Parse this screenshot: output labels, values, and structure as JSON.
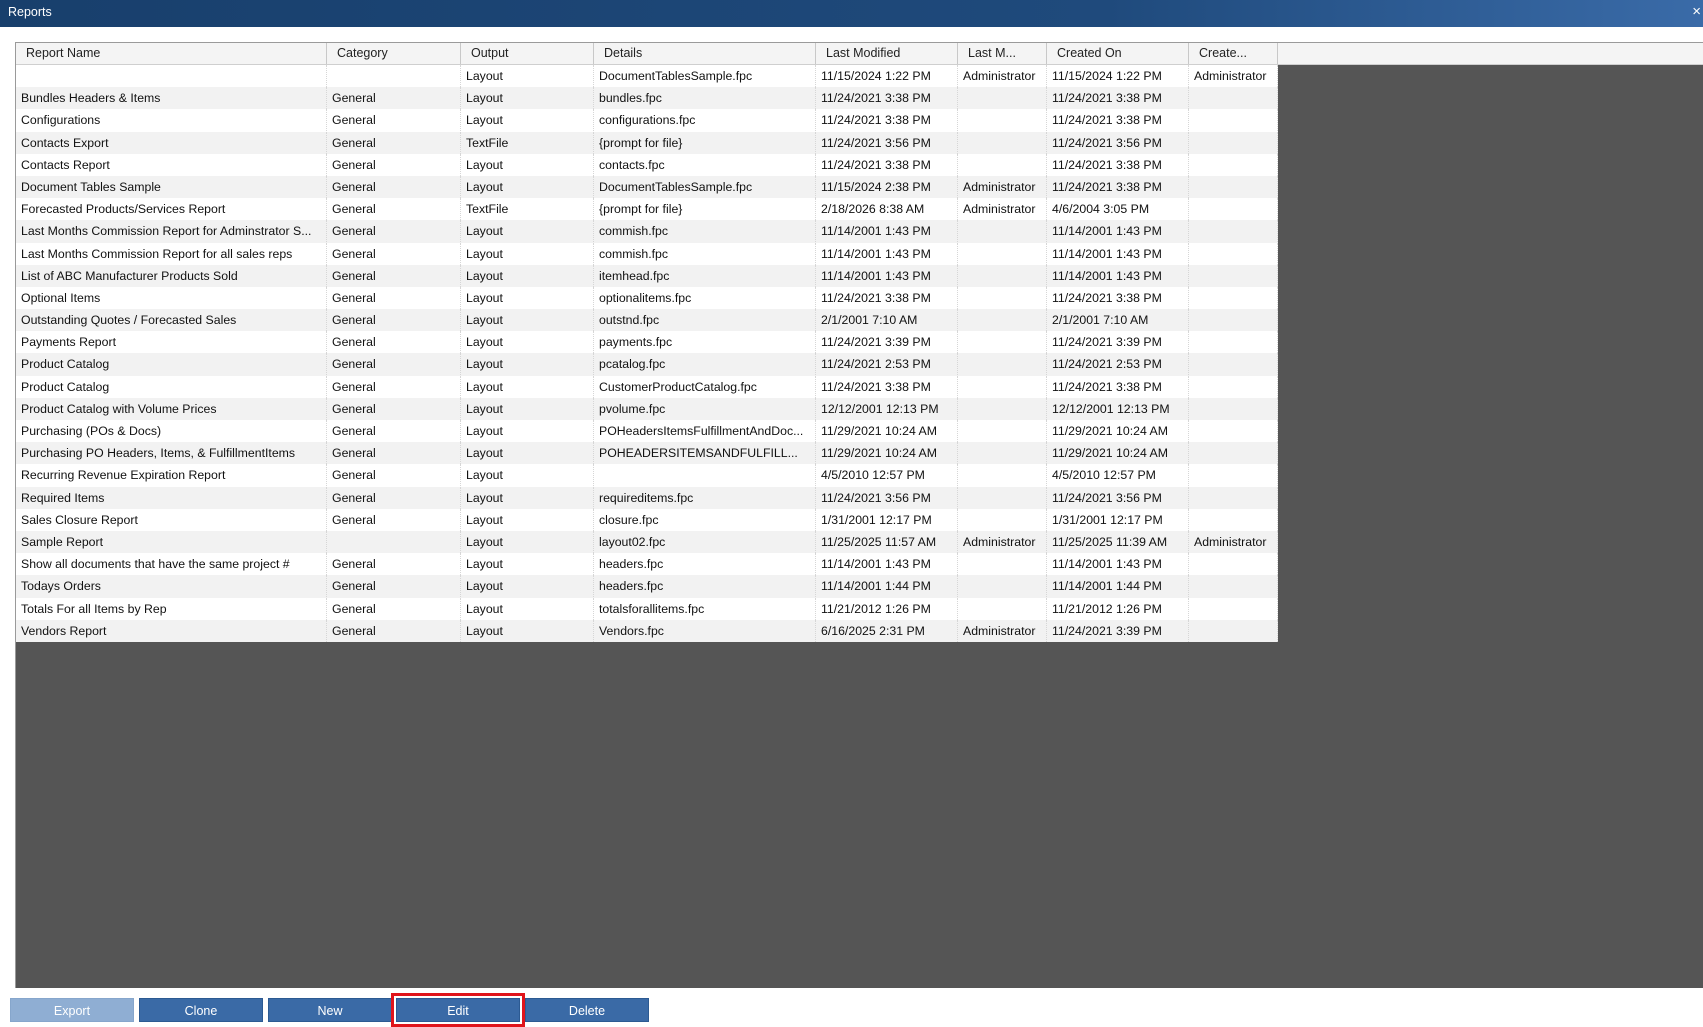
{
  "window": {
    "title": "Reports",
    "close_glyph": "×"
  },
  "table": {
    "columns": [
      "Report Name",
      "Category",
      "Output",
      "Details",
      "Last Modified",
      "Last M...",
      "Created On",
      "Create..."
    ],
    "rows": [
      [
        "",
        "",
        "Layout",
        "DocumentTablesSample.fpc",
        "11/15/2024 1:22 PM",
        "Administrator",
        "11/15/2024 1:22 PM",
        "Administrator"
      ],
      [
        "Bundles Headers & Items",
        "General",
        "Layout",
        "bundles.fpc",
        "11/24/2021 3:38 PM",
        "",
        "11/24/2021 3:38 PM",
        ""
      ],
      [
        "Configurations",
        "General",
        "Layout",
        "configurations.fpc",
        "11/24/2021 3:38 PM",
        "",
        "11/24/2021 3:38 PM",
        ""
      ],
      [
        "Contacts Export",
        "General",
        "TextFile",
        "{prompt for file}",
        "11/24/2021 3:56 PM",
        "",
        "11/24/2021 3:56 PM",
        ""
      ],
      [
        "Contacts Report",
        "General",
        "Layout",
        "contacts.fpc",
        "11/24/2021 3:38 PM",
        "",
        "11/24/2021 3:38 PM",
        ""
      ],
      [
        "Document Tables Sample",
        "General",
        "Layout",
        "DocumentTablesSample.fpc",
        "11/15/2024 2:38 PM",
        "Administrator",
        "11/24/2021 3:38 PM",
        ""
      ],
      [
        "Forecasted Products/Services Report",
        "General",
        "TextFile",
        "{prompt for file}",
        "2/18/2026 8:38 AM",
        "Administrator",
        "4/6/2004 3:05 PM",
        ""
      ],
      [
        "Last Months Commission Report for Adminstrator S...",
        "General",
        "Layout",
        "commish.fpc",
        "11/14/2001 1:43 PM",
        "",
        "11/14/2001 1:43 PM",
        ""
      ],
      [
        "Last Months Commission Report for all sales reps",
        "General",
        "Layout",
        "commish.fpc",
        "11/14/2001 1:43 PM",
        "",
        "11/14/2001 1:43 PM",
        ""
      ],
      [
        "List of ABC Manufacturer Products Sold",
        "General",
        "Layout",
        "itemhead.fpc",
        "11/14/2001 1:43 PM",
        "",
        "11/14/2001 1:43 PM",
        ""
      ],
      [
        "Optional Items",
        "General",
        "Layout",
        "optionalitems.fpc",
        "11/24/2021 3:38 PM",
        "",
        "11/24/2021 3:38 PM",
        ""
      ],
      [
        "Outstanding Quotes / Forecasted Sales",
        "General",
        "Layout",
        "outstnd.fpc",
        "2/1/2001 7:10 AM",
        "",
        "2/1/2001 7:10 AM",
        ""
      ],
      [
        "Payments Report",
        "General",
        "Layout",
        "payments.fpc",
        "11/24/2021 3:39 PM",
        "",
        "11/24/2021 3:39 PM",
        ""
      ],
      [
        "Product Catalog",
        "General",
        "Layout",
        "pcatalog.fpc",
        "11/24/2021 2:53 PM",
        "",
        "11/24/2021 2:53 PM",
        ""
      ],
      [
        "Product Catalog",
        "General",
        "Layout",
        "CustomerProductCatalog.fpc",
        "11/24/2021 3:38 PM",
        "",
        "11/24/2021 3:38 PM",
        ""
      ],
      [
        "Product Catalog with Volume Prices",
        "General",
        "Layout",
        "pvolume.fpc",
        "12/12/2001 12:13 PM",
        "",
        "12/12/2001 12:13 PM",
        ""
      ],
      [
        "Purchasing (POs & Docs)",
        "General",
        "Layout",
        "POHeadersItemsFulfillmentAndDoc...",
        "11/29/2021 10:24 AM",
        "",
        "11/29/2021 10:24 AM",
        ""
      ],
      [
        "Purchasing PO Headers, Items, & FulfillmentItems",
        "General",
        "Layout",
        "POHEADERSITEMSANDFULFILL...",
        "11/29/2021 10:24 AM",
        "",
        "11/29/2021 10:24 AM",
        ""
      ],
      [
        "Recurring Revenue Expiration Report",
        "General",
        "Layout",
        "",
        "4/5/2010 12:57 PM",
        "",
        "4/5/2010 12:57 PM",
        ""
      ],
      [
        "Required Items",
        "General",
        "Layout",
        "requireditems.fpc",
        "11/24/2021 3:56 PM",
        "",
        "11/24/2021 3:56 PM",
        ""
      ],
      [
        "Sales Closure Report",
        "General",
        "Layout",
        "closure.fpc",
        "1/31/2001 12:17 PM",
        "",
        "1/31/2001 12:17 PM",
        ""
      ],
      [
        "Sample Report",
        "",
        "Layout",
        "layout02.fpc",
        "11/25/2025 11:57 AM",
        "Administrator",
        "11/25/2025 11:39 AM",
        "Administrator"
      ],
      [
        "Show all documents that have the same project #",
        "General",
        "Layout",
        "headers.fpc",
        "11/14/2001 1:43 PM",
        "",
        "11/14/2001 1:43 PM",
        ""
      ],
      [
        "Todays Orders",
        "General",
        "Layout",
        "headers.fpc",
        "11/14/2001 1:44 PM",
        "",
        "11/14/2001 1:44 PM",
        ""
      ],
      [
        "Totals For all Items by Rep",
        "General",
        "Layout",
        "totalsforallitems.fpc",
        "11/21/2012 1:26 PM",
        "",
        "11/21/2012 1:26 PM",
        ""
      ],
      [
        "Vendors Report",
        "General",
        "Layout",
        "Vendors.fpc",
        "6/16/2025 2:31 PM",
        "Administrator",
        "11/24/2021 3:39 PM",
        ""
      ]
    ]
  },
  "buttons": {
    "export": "Export",
    "clone": "Clone",
    "new": "New",
    "edit": "Edit",
    "delete": "Delete"
  },
  "colors": {
    "title_bar": "#1f4a7c",
    "button": "#3a6aa6",
    "button_disabled": "#8faed3",
    "grid_empty": "#555555",
    "highlight": "#e0141b"
  }
}
